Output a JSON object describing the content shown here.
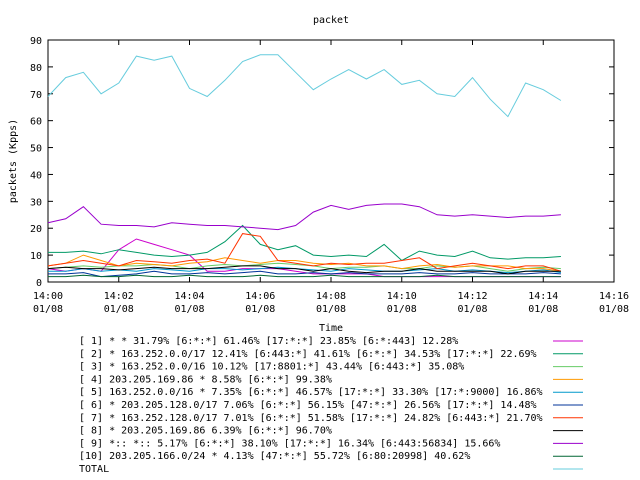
{
  "chart_data": {
    "type": "line",
    "title": "packet",
    "xlabel": "Time",
    "ylabel": "packets (Kpps)",
    "ylim": [
      0,
      90
    ],
    "xlim": [
      0,
      16
    ],
    "y_ticks": [
      "0",
      "10",
      "20",
      "30",
      "40",
      "50",
      "60",
      "70",
      "80",
      "90"
    ],
    "x_ticks": [
      {
        "time": "14:00",
        "date": "01/08"
      },
      {
        "time": "14:02",
        "date": "01/08"
      },
      {
        "time": "14:04",
        "date": "01/08"
      },
      {
        "time": "14:06",
        "date": "01/08"
      },
      {
        "time": "14:08",
        "date": "01/08"
      },
      {
        "time": "14:10",
        "date": "01/08"
      },
      {
        "time": "14:12",
        "date": "01/08"
      },
      {
        "time": "14:14",
        "date": "01/08"
      },
      {
        "time": "14:16",
        "date": "01/08"
      }
    ],
    "grid": false,
    "legend_position": "bottom",
    "x": [
      0,
      0.5,
      1,
      1.5,
      2,
      2.5,
      3,
      3.5,
      4,
      4.5,
      5,
      5.5,
      6,
      6.5,
      7,
      7.5,
      8,
      8.5,
      9,
      9.5,
      10,
      10.5,
      11,
      11.5,
      12,
      12.5,
      13,
      13.5,
      14,
      14.5
    ],
    "series": [
      {
        "name": "[ 1] * * 31.79%  [6:*:*] 61.46% [17:*:*] 23.85% [6:*:443] 12.28%",
        "color": "#cc00cc",
        "values": [
          5,
          4,
          5,
          4,
          12,
          16,
          14,
          12,
          10,
          4,
          4,
          5,
          5,
          5,
          4,
          3,
          3,
          3,
          3,
          2,
          2,
          2,
          2,
          2,
          2,
          2,
          2,
          2,
          2,
          2
        ]
      },
      {
        "name": "[ 2] * 163.252.0.0/17 12.41%  [6:443:*] 41.61% [6:*:*] 34.53% [17:*:*] 22.69%",
        "color": "#009966",
        "values": [
          11,
          11,
          11.5,
          10.5,
          12,
          11,
          10,
          9.5,
          10,
          11,
          15,
          21,
          14,
          12,
          13.5,
          10,
          9.5,
          10,
          9.5,
          14,
          8,
          11.5,
          10,
          9.5,
          11.5,
          9,
          8.5,
          9,
          9,
          9.5
        ]
      },
      {
        "name": "[ 3] * 163.252.0.0/16 10.12%  [17:8801:*] 43.44% [6:443:*] 35.08%",
        "color": "#66cc66",
        "values": [
          5,
          5.5,
          6,
          5.5,
          6,
          6,
          6.5,
          6,
          5,
          6,
          6.5,
          6,
          6.5,
          7,
          6.5,
          6,
          5,
          5.5,
          5.5,
          6,
          5,
          5,
          6,
          5.5,
          6,
          5,
          4,
          5,
          5.5,
          5
        ]
      },
      {
        "name": "[ 4] 203.205.169.86 * 8.58%  [6:*:*] 99.38%",
        "color": "#ff9900",
        "values": [
          6,
          7,
          10,
          8,
          6,
          7,
          6.5,
          6,
          7,
          7.5,
          9,
          8,
          7,
          8,
          8,
          7,
          6.5,
          7,
          6,
          6,
          5,
          6,
          6.5,
          5.5,
          6,
          6,
          6,
          5,
          5,
          4
        ]
      },
      {
        "name": "[ 5] 163.252.0.0/16 * 7.35%  [6:*:*] 46.57% [17:*:*] 33.30% [17:*:9000] 16.86%",
        "color": "#0099cc",
        "values": [
          4,
          4,
          5,
          4,
          4.5,
          4,
          5,
          4.5,
          4,
          5,
          5,
          4.5,
          5,
          5.5,
          5,
          4.5,
          4,
          5,
          4.5,
          4,
          4,
          4.5,
          5,
          4,
          4.5,
          4,
          3.5,
          4,
          4.5,
          3.5
        ]
      },
      {
        "name": "[ 6] * 203.205.128.0/17 7.06%  [6:*:*] 56.15% [47:*:*] 26.56% [17:*:*] 14.48%",
        "color": "#003399",
        "values": [
          3,
          3,
          3.5,
          2,
          2.5,
          3,
          4,
          3,
          3,
          3.5,
          3,
          3.5,
          4,
          3,
          3,
          3.5,
          3,
          3.5,
          3,
          3,
          3,
          3.5,
          3,
          3,
          3.5,
          3,
          3,
          3,
          3.5,
          3
        ]
      },
      {
        "name": "[ 7] * 163.252.128.0/17 7.01%  [6:*:*] 51.58% [17:*:*] 24.82% [6:443:*] 21.70%",
        "color": "#ff3300",
        "values": [
          6,
          7,
          8,
          7,
          6,
          8,
          7.5,
          7,
          8,
          8.5,
          7,
          18,
          17,
          8,
          7,
          6,
          7,
          6.5,
          7,
          7,
          8,
          9,
          5,
          6,
          7,
          6,
          5,
          6,
          6,
          4
        ]
      },
      {
        "name": "[ 8] * 203.205.169.86 6.39%  [6:*:*] 96.70%",
        "color": "#000000",
        "values": [
          5,
          5.5,
          5,
          5,
          4.5,
          5,
          5.5,
          5,
          5,
          5,
          5.5,
          6,
          6,
          5,
          5,
          4,
          5,
          4,
          3.5,
          4,
          4,
          5,
          4,
          4,
          4,
          4,
          3,
          4,
          4,
          4
        ]
      },
      {
        "name": "[ 9] *:: *:: 5.17%  [6:*:*] 38.10% [17:*:*] 16.34% [6:443:56834] 15.66%",
        "color": "#9900cc",
        "values": [
          22,
          23.5,
          28,
          21.5,
          21,
          21,
          20.5,
          22,
          21.5,
          21,
          21,
          20.5,
          20,
          19.5,
          21,
          26,
          28.5,
          27,
          28.5,
          29,
          29,
          28,
          25,
          24.5,
          25,
          24.5,
          24,
          24.5,
          24.5,
          25
        ]
      },
      {
        "name": "[10] 203.205.166.0/24 * 4.13%  [47:*:*] 55.72% [6:80:20998] 40.62%",
        "color": "#006633",
        "values": [
          2,
          2,
          2.5,
          2,
          2,
          2.5,
          2,
          2,
          2.5,
          2,
          2,
          2,
          2.5,
          2,
          2,
          2,
          2.5,
          2,
          2,
          2,
          2,
          2,
          2.5,
          2,
          2,
          2,
          2,
          2,
          2,
          2
        ]
      },
      {
        "name": "TOTAL",
        "color": "#66ccdd",
        "values": [
          69,
          76,
          78,
          70,
          74,
          84,
          82.5,
          84,
          72,
          69,
          75,
          82,
          84.5,
          84.5,
          78,
          71.5,
          75.5,
          79,
          75.5,
          79,
          73.5,
          75,
          70,
          69,
          76,
          68,
          61.5,
          74,
          71.5,
          67.5
        ]
      }
    ]
  }
}
